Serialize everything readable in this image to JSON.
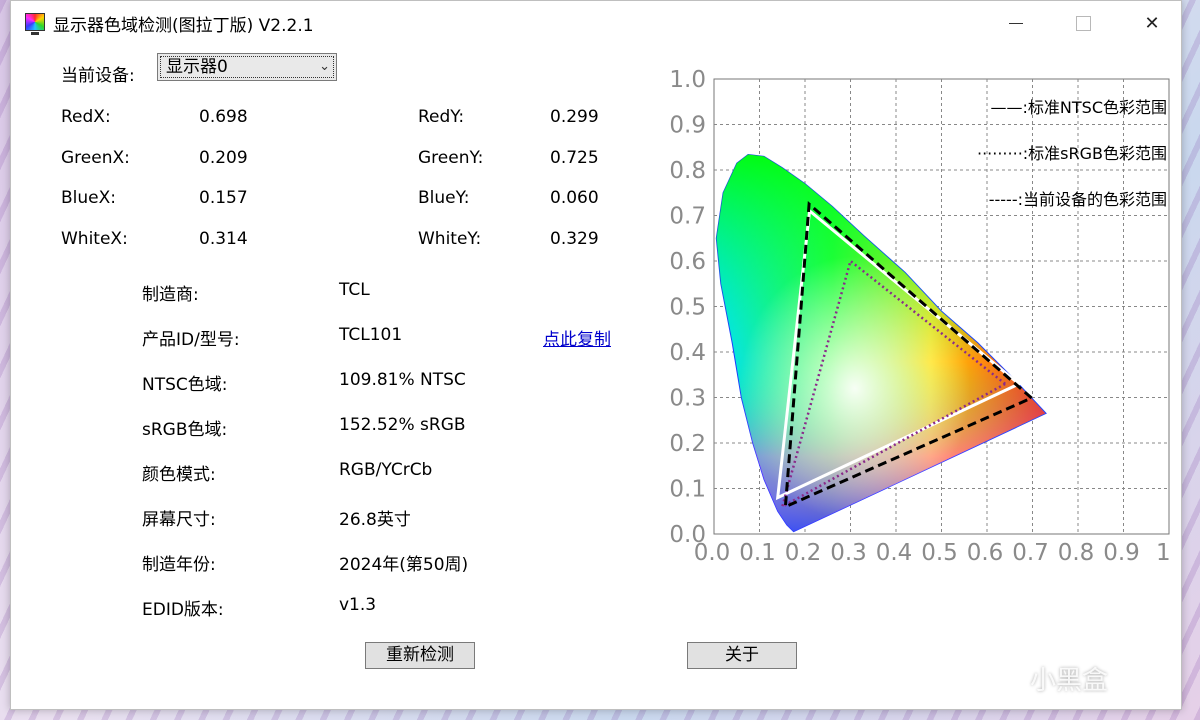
{
  "window": {
    "title": "显示器色域检测(图拉丁版) V2.2.1"
  },
  "device": {
    "label": "当前设备:",
    "selected": "显示器0"
  },
  "coords": [
    {
      "xlabel": "RedX:",
      "xval": "0.698",
      "ylabel": "RedY:",
      "yval": "0.299"
    },
    {
      "xlabel": "GreenX:",
      "xval": "0.209",
      "ylabel": "GreenY:",
      "yval": "0.725"
    },
    {
      "xlabel": "BlueX:",
      "xval": "0.157",
      "ylabel": "BlueY:",
      "yval": "0.060"
    },
    {
      "xlabel": "WhiteX:",
      "xval": "0.314",
      "ylabel": "WhiteY:",
      "yval": "0.329"
    }
  ],
  "info": [
    {
      "label": "制造商:",
      "value": "TCL"
    },
    {
      "label": "产品ID/型号:",
      "value": "TCL101"
    },
    {
      "label": "NTSC色域:",
      "value": "109.81% NTSC"
    },
    {
      "label": "sRGB色域:",
      "value": "152.52% sRGB"
    },
    {
      "label": "颜色模式:",
      "value": "RGB/YCrCb"
    },
    {
      "label": "屏幕尺寸:",
      "value": "26.8英寸"
    },
    {
      "label": "制造年份:",
      "value": "2024年(第50周)"
    },
    {
      "label": "EDID版本:",
      "value": "v1.3"
    }
  ],
  "copy_link": "点此复制",
  "buttons": {
    "redetect": "重新检测",
    "about": "关于"
  },
  "watermark": "小黑盒",
  "chart_data": {
    "type": "scatter",
    "xlim": [
      0,
      1
    ],
    "ylim": [
      0,
      1
    ],
    "grid": true,
    "x_ticks": [
      "0.0",
      "0.1",
      "0.2",
      "0.3",
      "0.4",
      "0.5",
      "0.6",
      "0.7",
      "0.8",
      "0.9",
      "1."
    ],
    "y_ticks": [
      "0.0",
      "0.1",
      "0.2",
      "0.3",
      "0.4",
      "0.5",
      "0.6",
      "0.7",
      "0.8",
      "0.9",
      "1.0"
    ],
    "legend_position": "top-right",
    "series": [
      {
        "name": "——:标准NTSC色彩范围",
        "style": "solid",
        "color": "#ffffff",
        "points": [
          [
            0.67,
            0.33
          ],
          [
            0.21,
            0.71
          ],
          [
            0.14,
            0.08
          ]
        ]
      },
      {
        "name": "·········:标准sRGB色彩范围",
        "style": "dotted",
        "color": "#8a2a8a",
        "points": [
          [
            0.64,
            0.33
          ],
          [
            0.3,
            0.6
          ],
          [
            0.15,
            0.06
          ]
        ]
      },
      {
        "name": "-----:当前设备的色彩范围",
        "style": "dashed",
        "color": "#000000",
        "points": [
          [
            0.698,
            0.299
          ],
          [
            0.209,
            0.725
          ],
          [
            0.157,
            0.06
          ]
        ]
      }
    ]
  }
}
